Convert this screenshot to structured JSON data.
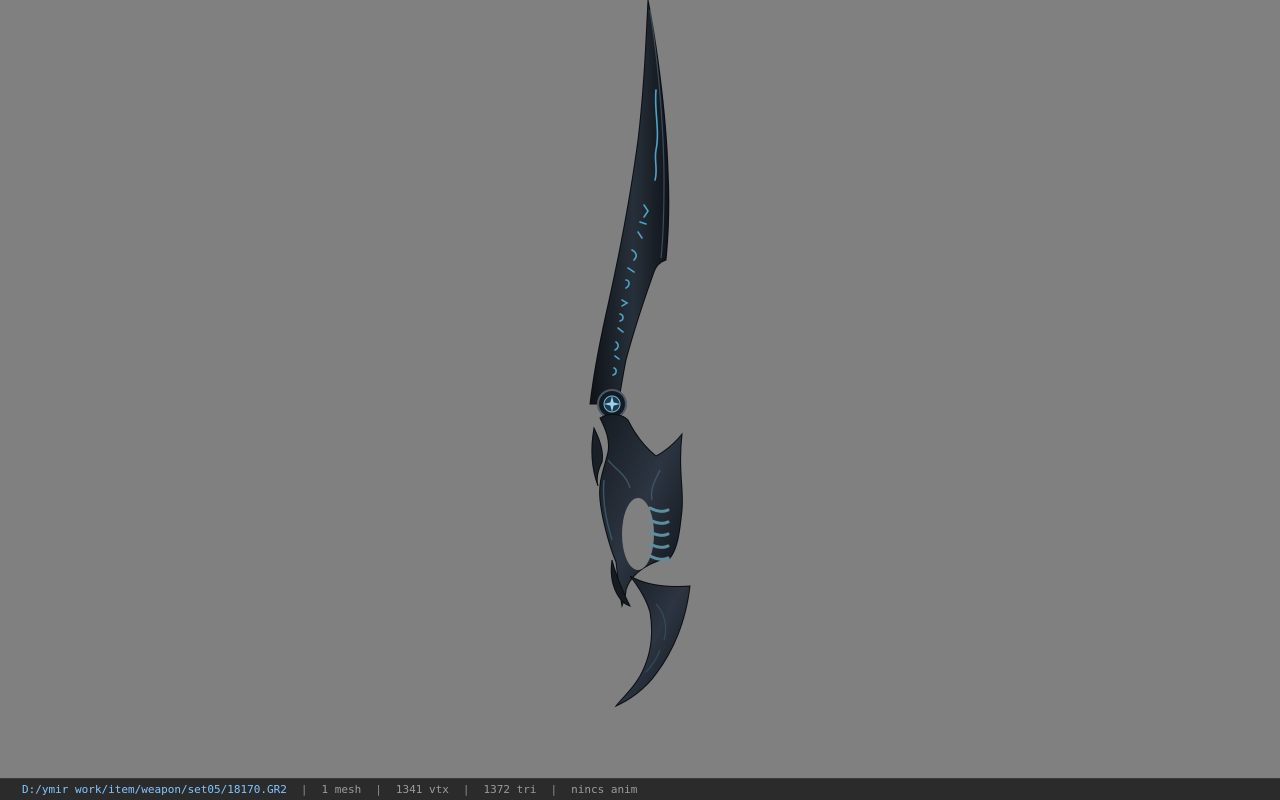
{
  "viewport": {
    "background_color": "#808080",
    "model": {
      "name": "sword-model",
      "rune_color": "#4fa3c8",
      "blade_color": "#1b2027"
    }
  },
  "statusbar": {
    "file_path": "D:/ymir work/item/weapon/set05/18170.GR2",
    "mesh_count": "1 mesh",
    "vertex_count": "1341 vtx",
    "triangle_count": "1372 tri",
    "anim_status": "nincs anim",
    "separator": "|"
  }
}
